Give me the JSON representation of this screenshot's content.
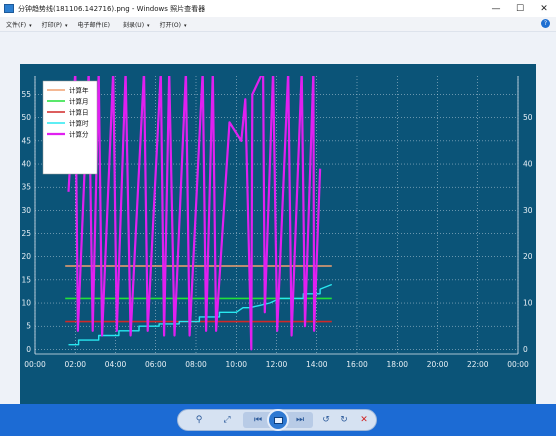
{
  "window": {
    "title": "分钟趋势线(181106.142716).png - Windows 照片查看器",
    "buttons": {
      "minimize": "—",
      "maximize": "☐",
      "close": "✕"
    }
  },
  "menu": {
    "items": [
      {
        "label": "文件(F)",
        "caret": "▾"
      },
      {
        "label": "打印(P)",
        "caret": "▾"
      },
      {
        "label": "电子邮件(E)",
        "caret": ""
      },
      {
        "label": "刻录(U)",
        "caret": "▾"
      },
      {
        "label": "打开(O)",
        "caret": "▾"
      }
    ],
    "help": "?"
  },
  "toolbar": {
    "zoom_icon": "⚲",
    "fit_icon": "⤢",
    "prev_icon": "⏮",
    "next_icon": "⏭",
    "rotate_ccw_icon": "↺",
    "rotate_cw_icon": "↻",
    "delete_icon": "✕"
  },
  "chart_data": {
    "type": "line",
    "background": "#0b5478",
    "grid": true,
    "legend_placement": "top-left",
    "xlim": [
      0,
      1440
    ],
    "ylim": [
      -1,
      59
    ],
    "x_ticks": [
      "00:00",
      "02:00",
      "04:00",
      "06:00",
      "08:00",
      "10:00",
      "12:00",
      "14:00",
      "16:00",
      "18:00",
      "20:00",
      "22:00",
      "00:00"
    ],
    "y_ticks": [
      0,
      5,
      10,
      15,
      20,
      25,
      30,
      35,
      40,
      45,
      50,
      55
    ],
    "y_ticks_right": [
      0,
      10,
      20,
      30,
      40,
      50
    ],
    "series": [
      {
        "name": "计算年",
        "color": "#f0a070",
        "width": 1.6,
        "x": [
          90,
          885
        ],
        "y": [
          18,
          18
        ]
      },
      {
        "name": "计算月",
        "color": "#22e03a",
        "width": 1.6,
        "x": [
          90,
          885
        ],
        "y": [
          11,
          11
        ]
      },
      {
        "name": "计算日",
        "color": "#d02828",
        "width": 1.6,
        "x": [
          90,
          885
        ],
        "y": [
          6,
          6
        ]
      },
      {
        "name": "计算时",
        "color": "#28e8f0",
        "width": 1.4,
        "x": [
          100,
          130,
          130,
          190,
          190,
          250,
          250,
          310,
          310,
          370,
          370,
          430,
          430,
          490,
          490,
          550,
          550,
          600,
          620,
          640,
          670,
          700,
          730,
          745,
          745,
          800,
          800,
          850,
          850,
          885
        ],
        "y": [
          1,
          1,
          2,
          2,
          3,
          3,
          4,
          4,
          5,
          5,
          5.5,
          5.5,
          6,
          6,
          7,
          7,
          8,
          8,
          9,
          9,
          9.5,
          10,
          11,
          11,
          11,
          11,
          12,
          12,
          13,
          14
        ]
      },
      {
        "name": "计算分",
        "color": "#e020f0",
        "width": 2.2,
        "x": [
          100,
          120,
          128,
          160,
          172,
          190,
          200,
          233,
          244,
          270,
          285,
          325,
          336,
          375,
          385,
          400,
          416,
          450,
          461,
          500,
          510,
          530,
          540,
          580,
          615,
          627,
          645,
          648,
          680,
          685,
          710,
          722,
          755,
          765,
          795,
          805,
          830,
          832,
          850
        ],
        "y": [
          34,
          60,
          4,
          60,
          4,
          60,
          3,
          60,
          4,
          60,
          3,
          60,
          4,
          60,
          3,
          60,
          3,
          60,
          3,
          60,
          4,
          60,
          4,
          49,
          45,
          54,
          0,
          55,
          60,
          8,
          60,
          4,
          60,
          3,
          60,
          5,
          60,
          4,
          39
        ]
      }
    ]
  }
}
